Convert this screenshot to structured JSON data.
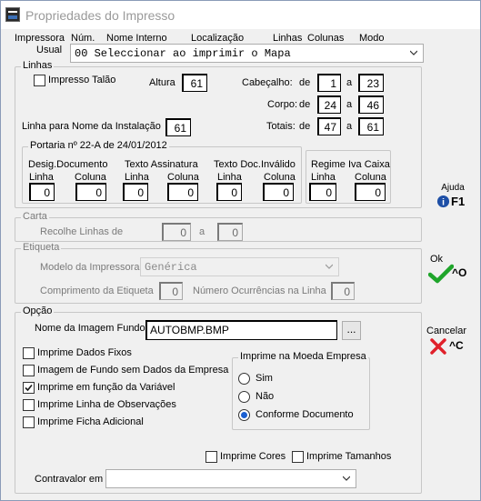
{
  "window": {
    "title": "Propriedades do Impresso"
  },
  "header": {
    "col_impressora": "Impressora",
    "col_usual": "Usual",
    "col_num": "Núm.",
    "col_nome_interno": "Nome Interno",
    "col_localizacao": "Localização",
    "col_linhas": "Linhas",
    "col_colunas": "Colunas",
    "col_modo": "Modo",
    "printer_value": "00 Seleccionar ao imprimir o Mapa"
  },
  "linhas": {
    "group_label": "Linhas",
    "impresso_talao": "Impresso Talão",
    "altura_label": "Altura",
    "altura": "61",
    "cabecalho_label": "Cabeçalho:",
    "de1": "de",
    "cab_de": "1",
    "a1": "a",
    "cab_a": "23",
    "corpo_label": "Corpo:",
    "de2": "de",
    "corpo_de": "24",
    "a2": "a",
    "corpo_a": "46",
    "totais_label": "Totais:",
    "de3": "de",
    "totais_de": "47",
    "a3": "a",
    "totais_a": "61",
    "linha_nome_label": "Linha para Nome da Instalação",
    "linha_nome": "61"
  },
  "portaria": {
    "group_label": "Portaria nº 22-A de 24/01/2012",
    "desig_label": "Desig.Documento",
    "texto_assin_label": "Texto Assinatura",
    "texto_doc_label": "Texto Doc.Inválido",
    "linha": "Linha",
    "coluna": "Coluna",
    "desig_linha": "0",
    "desig_coluna": "0",
    "assin_linha": "0",
    "assin_coluna": "0",
    "inv_linha": "0",
    "inv_coluna": "0",
    "regime_label": "Regime Iva Caixa",
    "regime_linha": "0",
    "regime_coluna": "0"
  },
  "carta": {
    "group_label": "Carta",
    "recolhe_label": "Recolhe Linhas de",
    "de": "0",
    "a_label": "a",
    "a": "0"
  },
  "etiqueta": {
    "group_label": "Etiqueta",
    "modelo_label": "Modelo da Impressora",
    "modelo_value": "Genérica",
    "comprimento_label": "Comprimento da Etiqueta",
    "comprimento": "0",
    "ocorrencias_label": "Número Ocurrências na Linha",
    "ocorrencias": "0"
  },
  "opcao": {
    "group_label": "Opção",
    "imagem_label": "Nome da Imagem Fundo",
    "imagem_value": "AUTOBMP.BMP",
    "browse": "...",
    "imprime_dados_fixos": "Imprime Dados Fixos",
    "imagem_fundo_sem_dados": "Imagem de Fundo sem Dados da Empresa",
    "imprime_funcao_variavel": "Imprime em função da Variável",
    "imprime_linha_obs": "Imprime Linha de Observações",
    "imprime_ficha_adicional": "Imprime Ficha Adicional",
    "moeda_group_label": "Imprime na Moeda Empresa",
    "sim": "Sim",
    "nao": "Não",
    "conforme": "Conforme Documento",
    "imprime_cores": "Imprime Cores",
    "imprime_tamanhos": "Imprime Tamanhos",
    "contravalor_label": "Contravalor em",
    "contravalor_value": ""
  },
  "side_buttons": {
    "ajuda_label": "Ajuda",
    "ajuda_key": "F1",
    "ok_label": "Ok",
    "ok_key": "^O",
    "cancelar_label": "Cancelar",
    "cancelar_key": "^C"
  },
  "colors": {
    "ok_check": "#1fa52b",
    "cancel_x": "#e0202a",
    "radio_selected": "#1a5fd1"
  }
}
